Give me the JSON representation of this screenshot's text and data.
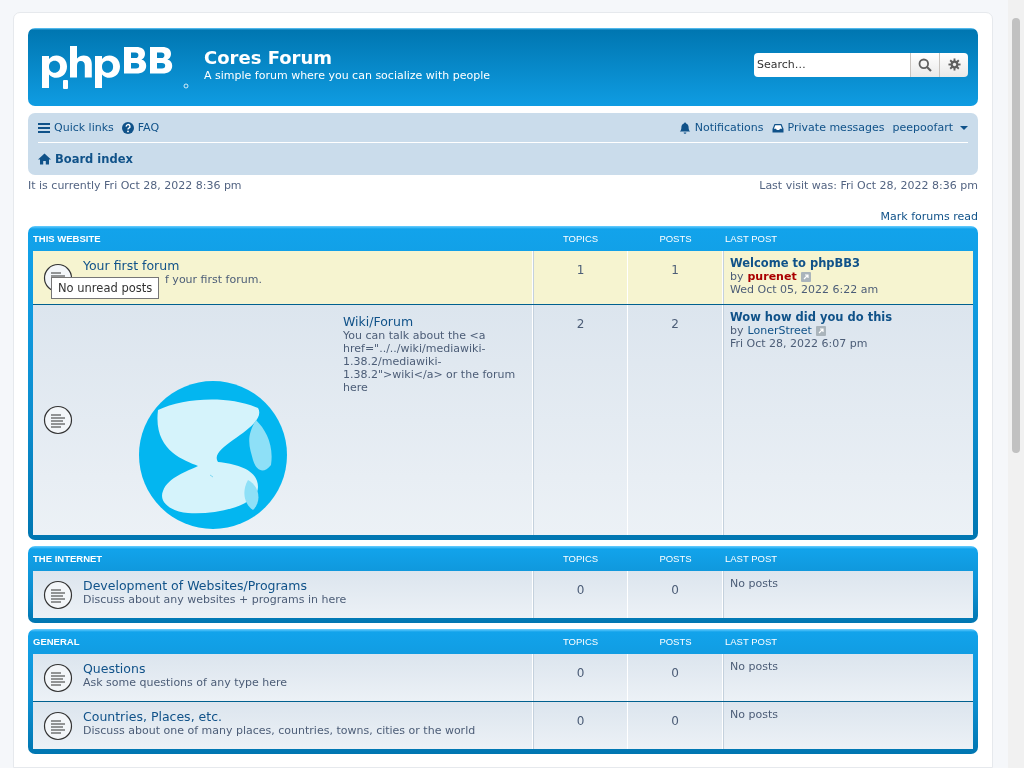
{
  "header": {
    "site_title": "Cores Forum",
    "site_description": "A simple forum where you can socialize with people",
    "search": {
      "placeholder": "Search…"
    }
  },
  "navbar": {
    "left": [
      {
        "label": "Quick links",
        "kind": "menu"
      },
      {
        "label": "FAQ",
        "kind": "help"
      }
    ],
    "right": [
      {
        "label": "Notifications",
        "kind": "bell"
      },
      {
        "label": "Private messages",
        "kind": "inbox"
      },
      {
        "label": "peepoofart",
        "kind": "user"
      }
    ],
    "breadcrumb": "Board index"
  },
  "current_time": "It is currently Fri Oct 28, 2022 8:36 pm",
  "last_visit": "Last visit was: Fri Oct 28, 2022 8:36 pm",
  "mark_read": "Mark forums read",
  "categories": [
    {
      "title": "THIS WEBSITE",
      "columns": [
        "TOPICS",
        "POSTS",
        "LAST POST"
      ],
      "forums": [
        {
          "name": "Your first forum",
          "description": "f your first forum.",
          "topics": "1",
          "posts": "1",
          "highlighted": true,
          "tooltip": "No unread posts",
          "last_post": {
            "title": "Welcome to phpBB3",
            "by": "by",
            "author": "purenet",
            "color": "#aa0000",
            "time": "Wed Oct 05, 2022 6:22 am"
          }
        },
        {
          "name": "Wiki/Forum",
          "description": "You can talk about the <a href=\"../../wiki/mediawiki-1.38.2/mediawiki-1.38.2\">wiki</a> or the forum here",
          "topics": "2",
          "posts": "2",
          "highlighted": false,
          "last_post": {
            "title": "Wow how did you do this",
            "by": "by",
            "author": "LonerStreet",
            "color": "#105289",
            "time": "Fri Oct 28, 2022 6:07 pm"
          }
        }
      ]
    },
    {
      "title": "THE INTERNET",
      "columns": [
        "TOPICS",
        "POSTS",
        "LAST POST"
      ],
      "forums": [
        {
          "name": "Development of Websites/Programs",
          "description": "Discuss about any websites + programs in here",
          "topics": "0",
          "posts": "0",
          "highlighted": false,
          "no_posts": "No posts"
        }
      ]
    },
    {
      "title": "GENERAL",
      "columns": [
        "TOPICS",
        "POSTS",
        "LAST POST"
      ],
      "forums": [
        {
          "name": "Questions",
          "description": "Ask some questions of any type here",
          "topics": "0",
          "posts": "0",
          "highlighted": false,
          "no_posts": "No posts"
        },
        {
          "name": "Countries, Places, etc.",
          "description": "Discuss about one of many places, countries, towns, cities or the world",
          "topics": "0",
          "posts": "0",
          "highlighted": false,
          "no_posts": "No posts"
        }
      ]
    }
  ]
}
